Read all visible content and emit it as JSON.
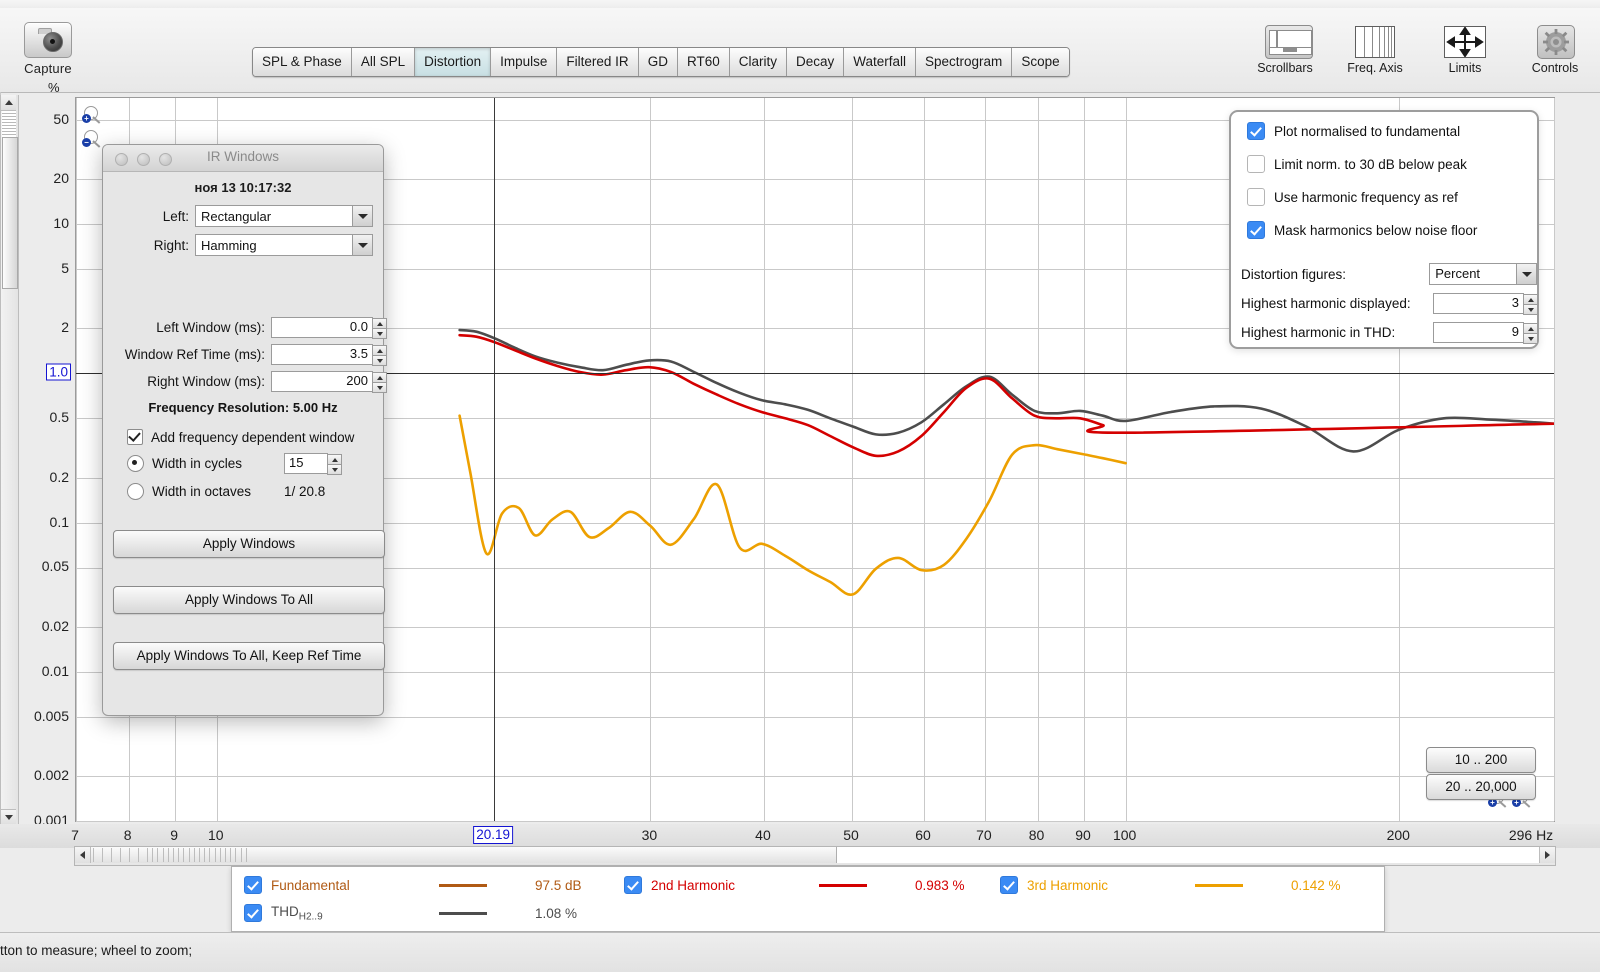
{
  "app": {
    "capture_label": "Capture",
    "status_text": "tton to measure; wheel to zoom;"
  },
  "tabs": [
    {
      "label": "SPL & Phase",
      "active": false
    },
    {
      "label": "All SPL",
      "active": false
    },
    {
      "label": "Distortion",
      "active": true
    },
    {
      "label": "Impulse",
      "active": false
    },
    {
      "label": "Filtered IR",
      "active": false
    },
    {
      "label": "GD",
      "active": false
    },
    {
      "label": "RT60",
      "active": false
    },
    {
      "label": "Clarity",
      "active": false
    },
    {
      "label": "Decay",
      "active": false
    },
    {
      "label": "Waterfall",
      "active": false
    },
    {
      "label": "Spectrogram",
      "active": false
    },
    {
      "label": "Scope",
      "active": false
    }
  ],
  "toolbar_icons": [
    {
      "label": "Scrollbars",
      "icon": "scrollbars-icon"
    },
    {
      "label": "Freq. Axis",
      "icon": "freq-axis-icon"
    },
    {
      "label": "Limits",
      "icon": "limits-icon"
    },
    {
      "label": "Controls",
      "icon": "gear-icon"
    }
  ],
  "ir_windows": {
    "title": "IR Windows",
    "date": "ноя 13 10:17:32",
    "left_label": "Left:",
    "left_value": "Rectangular",
    "right_label": "Right:",
    "right_value": "Hamming",
    "left_window_label": "Left Window (ms):",
    "left_window_value": "0.0",
    "ref_time_label": "Window Ref Time (ms):",
    "ref_time_value": "3.5",
    "right_window_label": "Right Window (ms):",
    "right_window_value": "200",
    "freq_res_label": "Frequency Resolution:",
    "freq_res_value": "5.00 Hz",
    "add_fdw_label": "Add frequency dependent window",
    "add_fdw_checked": true,
    "width_cycles_label": "Width in cycles",
    "width_cycles_selected": true,
    "width_cycles_value": "15",
    "width_octaves_label": "Width in octaves",
    "width_octaves_value": "1/ 20.8",
    "buttons": [
      "Apply Windows",
      "Apply Windows To All",
      "Apply Windows To All, Keep Ref Time"
    ]
  },
  "distortion_panel": {
    "checkboxes": [
      {
        "label": "Plot normalised to fundamental",
        "checked": true
      },
      {
        "label": "Limit norm. to 30 dB below peak",
        "checked": false
      },
      {
        "label": "Use harmonic frequency as ref",
        "checked": false
      },
      {
        "label": "Mask harmonics below noise floor",
        "checked": true
      }
    ],
    "distortion_figures_label": "Distortion figures:",
    "distortion_figures_value": "Percent",
    "highest_displayed_label": "Highest harmonic displayed:",
    "highest_displayed_value": "3",
    "highest_thd_label": "Highest harmonic in THD:",
    "highest_thd_value": "9"
  },
  "range_buttons": [
    "10 .. 200",
    "20 .. 20,000"
  ],
  "legend": [
    {
      "name": "Fundamental",
      "sub": "",
      "value": "97.5 dB",
      "color": "#b05a14",
      "checked": true
    },
    {
      "name": "THD",
      "sub": "H2..9",
      "value": "1.08 %",
      "color": "#4d4d4d",
      "checked": true
    },
    {
      "name": "2nd Harmonic",
      "sub": "",
      "value": "0.983 %",
      "color": "#d40000",
      "checked": true
    },
    {
      "name": "3rd Harmonic",
      "sub": "",
      "value": "0.142 %",
      "color": "#eda000",
      "checked": true
    }
  ],
  "cursor": {
    "x_label": "20.19",
    "y_label": "1.0"
  },
  "chart_data": {
    "type": "line",
    "title": "",
    "xlabel": "296 Hz",
    "ylabel": "%",
    "xscale": "log",
    "yscale": "log",
    "xlim": [
      7,
      296
    ],
    "ylim": [
      0.001,
      70
    ],
    "grid": true,
    "xticks": [
      7,
      8,
      9,
      10,
      20.19,
      30,
      40,
      50,
      60,
      70,
      80,
      90,
      100,
      200,
      296
    ],
    "xtick_labels": [
      "7",
      "8",
      "9",
      "10",
      "20.19",
      "30",
      "40",
      "50",
      "60",
      "70",
      "80",
      "90",
      "100",
      "200",
      "296 Hz"
    ],
    "yticks": [
      50,
      20,
      10,
      5,
      2,
      1.0,
      0.5,
      0.2,
      0.1,
      0.05,
      0.02,
      0.01,
      0.005,
      0.002,
      0.001
    ],
    "ytick_labels": [
      "50",
      "20",
      "10",
      "5",
      "2",
      "1.0",
      "0.5",
      "0.2",
      "0.1",
      "0.05",
      "0.02",
      "0.01",
      "0.005",
      "0.002",
      "0.001"
    ],
    "legend_position": "bottom",
    "series": [
      {
        "name": "THD H2..9",
        "color": "#4d4d4d",
        "x": [
          18.5,
          19.3,
          20.2,
          21.2,
          22.4,
          23.7,
          25.1,
          26.6,
          28.2,
          29.9,
          31.6,
          33.5,
          35.5,
          37.6,
          39.8,
          42.2,
          44.7,
          47.3,
          50.1,
          53.1,
          56.2,
          59.6,
          63.1,
          66.8,
          70.8,
          75.0,
          79.4,
          84.1,
          89.1,
          94.4,
          100.0,
          112.0,
          125.0,
          141.0,
          158.0,
          178.0,
          200.0,
          224.0,
          251.0,
          282.0,
          296.0
        ],
        "y": [
          1.95,
          1.9,
          1.72,
          1.5,
          1.3,
          1.18,
          1.1,
          1.05,
          1.14,
          1.22,
          1.2,
          1.02,
          0.86,
          0.74,
          0.66,
          0.62,
          0.57,
          0.5,
          0.44,
          0.39,
          0.4,
          0.47,
          0.62,
          0.82,
          0.95,
          0.72,
          0.56,
          0.54,
          0.56,
          0.52,
          0.48,
          0.55,
          0.6,
          0.58,
          0.44,
          0.3,
          0.42,
          0.5,
          0.49,
          0.47,
          0.46
        ]
      },
      {
        "name": "2nd Harmonic",
        "color": "#d40000",
        "x": [
          18.5,
          19.3,
          20.2,
          21.2,
          22.4,
          23.7,
          25.1,
          26.6,
          28.2,
          29.9,
          31.6,
          33.5,
          35.5,
          37.6,
          39.8,
          42.2,
          44.7,
          47.3,
          50.1,
          53.1,
          56.2,
          59.6,
          63.1,
          66.8,
          70.8,
          75.0,
          79.4,
          84.1,
          89.1,
          94.4,
          100.0,
          296.0
        ],
        "y": [
          1.8,
          1.76,
          1.62,
          1.44,
          1.26,
          1.12,
          1.02,
          0.98,
          1.05,
          1.1,
          1.02,
          0.85,
          0.72,
          0.62,
          0.55,
          0.5,
          0.45,
          0.38,
          0.32,
          0.28,
          0.3,
          0.38,
          0.55,
          0.8,
          0.92,
          0.68,
          0.52,
          0.5,
          0.5,
          0.45,
          0.4,
          0.46
        ]
      },
      {
        "name": "3rd Harmonic",
        "color": "#eda000",
        "x": [
          18.5,
          19.0,
          19.8,
          20.6,
          21.5,
          22.4,
          23.4,
          24.5,
          25.7,
          27.0,
          28.5,
          30.0,
          31.6,
          33.5,
          35.5,
          37.6,
          39.8,
          42.2,
          44.7,
          47.3,
          50.1,
          53.1,
          56.2,
          59.6,
          63.1,
          66.8,
          70.8,
          75.0,
          79.4,
          84.1,
          89.1,
          94.4,
          100.0
        ],
        "y": [
          0.52,
          0.22,
          0.062,
          0.115,
          0.125,
          0.082,
          0.105,
          0.118,
          0.08,
          0.092,
          0.118,
          0.095,
          0.071,
          0.106,
          0.18,
          0.068,
          0.072,
          0.06,
          0.048,
          0.04,
          0.033,
          0.049,
          0.058,
          0.048,
          0.052,
          0.078,
          0.14,
          0.285,
          0.33,
          0.31,
          0.29,
          0.27,
          0.25
        ]
      }
    ]
  }
}
